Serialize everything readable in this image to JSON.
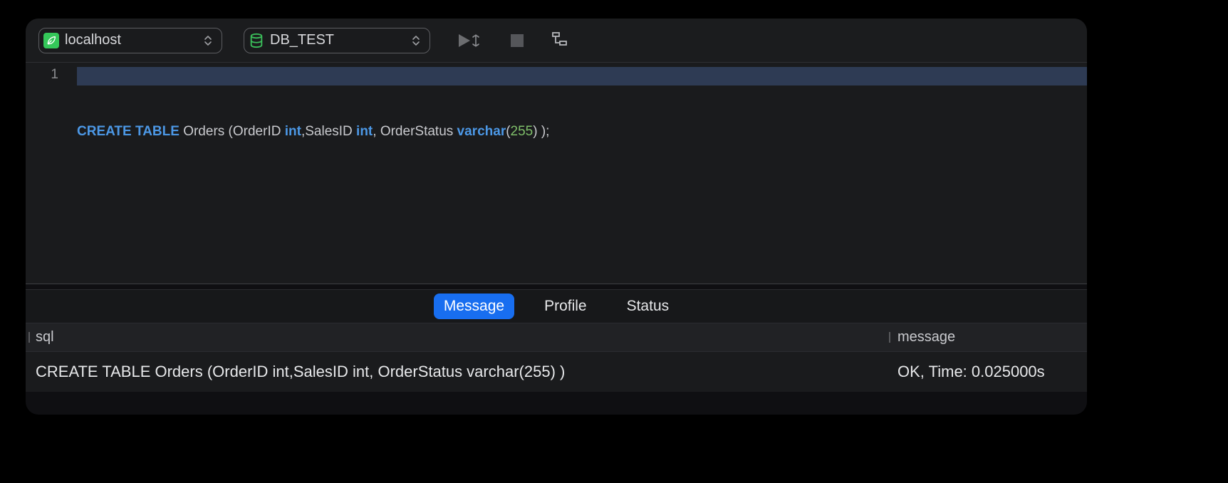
{
  "toolbar": {
    "connection": {
      "label": "localhost"
    },
    "database": {
      "label": "DB_TEST"
    }
  },
  "editor": {
    "line_number": "1",
    "code_tokens": [
      {
        "t": "CREATE",
        "c": "kw"
      },
      {
        "t": " "
      },
      {
        "t": "TABLE",
        "c": "kw"
      },
      {
        "t": " Orders (OrderID "
      },
      {
        "t": "int",
        "c": "ty"
      },
      {
        "t": ",SalesID "
      },
      {
        "t": "int",
        "c": "ty"
      },
      {
        "t": ", OrderStatus "
      },
      {
        "t": "varchar",
        "c": "ty"
      },
      {
        "t": "("
      },
      {
        "t": "255",
        "c": "num"
      },
      {
        "t": ") );"
      }
    ]
  },
  "results": {
    "tabs": [
      {
        "label": "Message",
        "active": true
      },
      {
        "label": "Profile",
        "active": false
      },
      {
        "label": "Status",
        "active": false
      }
    ],
    "columns": {
      "sql": "sql",
      "message": "message"
    },
    "rows": [
      {
        "sql": "CREATE TABLE Orders (OrderID int,SalesID int, OrderStatus varchar(255) )",
        "message": "OK, Time: 0.025000s"
      }
    ]
  }
}
